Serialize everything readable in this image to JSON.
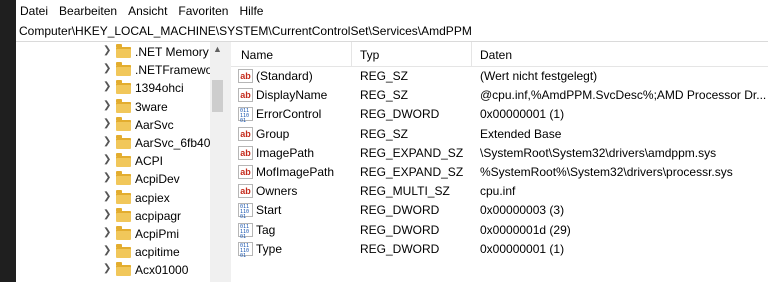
{
  "menu": [
    "Datei",
    "Bearbeiten",
    "Ansicht",
    "Favoriten",
    "Hilfe"
  ],
  "address": "Computer\\HKEY_LOCAL_MACHINE\\SYSTEM\\CurrentControlSet\\Services\\AmdPPM",
  "tree": [
    ".NET Memory",
    ".NETFramewo",
    "1394ohci",
    "3ware",
    "AarSvc",
    "AarSvc_6fb40",
    "ACPI",
    "AcpiDev",
    "acpiex",
    "acpipagr",
    "AcpiPmi",
    "acpitime",
    "Acx01000"
  ],
  "columns": {
    "name": "Name",
    "type": "Typ",
    "data": "Daten"
  },
  "values": [
    {
      "name": "(Standard)",
      "type": "REG_SZ",
      "data": "(Wert nicht festgelegt)",
      "icon": "string-value-icon"
    },
    {
      "name": "DisplayName",
      "type": "REG_SZ",
      "data": "@cpu.inf,%AmdPPM.SvcDesc%;AMD Processor Dr...",
      "icon": "string-value-icon"
    },
    {
      "name": "ErrorControl",
      "type": "REG_DWORD",
      "data": "0x00000001 (1)",
      "icon": "binary-value-icon"
    },
    {
      "name": "Group",
      "type": "REG_SZ",
      "data": "Extended Base",
      "icon": "string-value-icon"
    },
    {
      "name": "ImagePath",
      "type": "REG_EXPAND_SZ",
      "data": "\\SystemRoot\\System32\\drivers\\amdppm.sys",
      "icon": "string-value-icon"
    },
    {
      "name": "MofImagePath",
      "type": "REG_EXPAND_SZ",
      "data": "%SystemRoot%\\System32\\drivers\\processr.sys",
      "icon": "string-value-icon"
    },
    {
      "name": "Owners",
      "type": "REG_MULTI_SZ",
      "data": "cpu.inf",
      "icon": "string-value-icon"
    },
    {
      "name": "Start",
      "type": "REG_DWORD",
      "data": "0x00000003 (3)",
      "icon": "binary-value-icon"
    },
    {
      "name": "Tag",
      "type": "REG_DWORD",
      "data": "0x0000001d (29)",
      "icon": "binary-value-icon"
    },
    {
      "name": "Type",
      "type": "REG_DWORD",
      "data": "0x00000001 (1)",
      "icon": "binary-value-icon"
    }
  ],
  "icon_glyphs": {
    "string": "ab",
    "binary": "011 110 01"
  }
}
